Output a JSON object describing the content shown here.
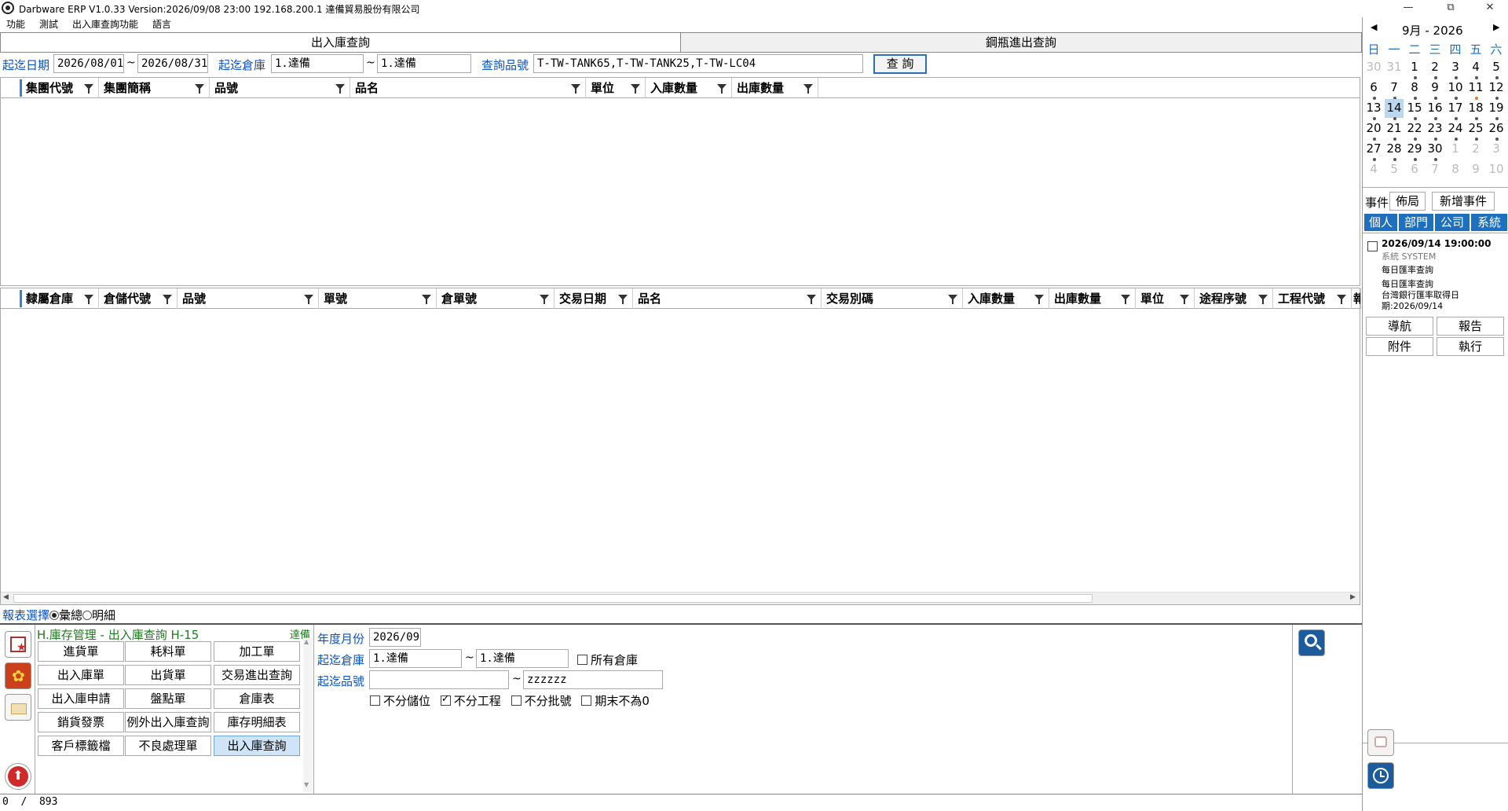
{
  "titlebar": {
    "title": "Darbware ERP V1.0.33 Version:2026/09/08 23:00   192.168.200.1 達備貿易股份有限公司",
    "min": "—",
    "restore": "⧉",
    "close": "✕"
  },
  "menu": [
    "功能",
    "測試",
    "出入庫查詢功能",
    "語言"
  ],
  "tabs": [
    "出入庫查詢",
    "鋼瓶進出查詢"
  ],
  "filter": {
    "date_label": "起迄日期",
    "date_from": "2026/08/01",
    "date_sep": "~",
    "date_to": "2026/08/31",
    "wh_label": "起迄倉庫",
    "wh_from": "1.達備",
    "wh_sep": "~",
    "wh_to": "1.達備",
    "item_label": "查詢品號",
    "item_value": "T-TW-TANK65,T-TW-TANK25,T-TW-LC04",
    "query_button": "查 詢"
  },
  "grid1": {
    "columns": [
      "集團代號",
      "集團簡稱",
      "品號",
      "品名",
      "單位",
      "入庫數量",
      "出庫數量"
    ]
  },
  "grid2": {
    "columns": [
      "隸屬倉庫",
      "倉儲代號",
      "品號",
      "單號",
      "倉單號",
      "交易日期",
      "品名",
      "交易別碼",
      "入庫數量",
      "出庫數量",
      "單位",
      "途程序號",
      "工程代號",
      "報"
    ]
  },
  "report": {
    "label": "報表選擇",
    "opt1": "彙總",
    "opt2": "明細"
  },
  "module": {
    "title": "H.庫存管理 - 出入庫查詢  H-15",
    "owner": "達備",
    "buttons": [
      "進貨單",
      "耗料單",
      "加工單",
      "出入庫單",
      "出貨單",
      "交易進出查詢",
      "出入庫申請",
      "盤點單",
      "倉庫表",
      "銷貨發票",
      "例外出入庫查詢",
      "庫存明細表",
      "客戶標籤檔",
      "不良處理單",
      "出入庫查詢"
    ],
    "selected": "出入庫查詢"
  },
  "params": {
    "ym_label": "年度月份",
    "ym_value": "2026/09",
    "wh_label": "起迄倉庫",
    "wh_from": "1.達備",
    "wh_sep": "~",
    "wh_to": "1.達備",
    "all_wh": "所有倉庫",
    "item_label": "起迄品號",
    "item_from": "",
    "item_sep": "~",
    "item_to": "zzzzzz",
    "chk1": "不分儲位",
    "chk2": "不分工程",
    "chk3": "不分批號",
    "chk4": "期末不為0"
  },
  "statusbar": {
    "text": "0  /  893"
  },
  "calendar": {
    "prev": "◀",
    "next": "▶",
    "month": "9月",
    "sep": "-",
    "year": "2026",
    "weekdays": [
      "日",
      "一",
      "二",
      "三",
      "四",
      "五",
      "六"
    ],
    "weeks": [
      [
        "30",
        "31",
        "1",
        "2",
        "3",
        "4",
        "5"
      ],
      [
        "6",
        "7",
        "8",
        "9",
        "10",
        "11",
        "12"
      ],
      [
        "13",
        "14",
        "15",
        "16",
        "17",
        "18",
        "19"
      ],
      [
        "20",
        "21",
        "22",
        "23",
        "24",
        "25",
        "26"
      ],
      [
        "27",
        "28",
        "29",
        "30",
        "1",
        "2",
        "3"
      ],
      [
        "4",
        "5",
        "6",
        "7",
        "8",
        "9",
        "10"
      ]
    ],
    "today": "14"
  },
  "events": {
    "label": "事件",
    "layout": "佈局",
    "add": "新增事件",
    "filters": [
      "個人",
      "部門",
      "公司",
      "系統"
    ],
    "item": {
      "time": "2026/09/14 19:00:00",
      "source": "系統  SYSTEM",
      "line1": "每日匯率查詢",
      "line2": "每日匯率查詢",
      "line3": "台灣銀行匯率取得日",
      "line4": "期:2026/09/14"
    },
    "actions": [
      "導航",
      "報告",
      "附件",
      "執行"
    ]
  }
}
